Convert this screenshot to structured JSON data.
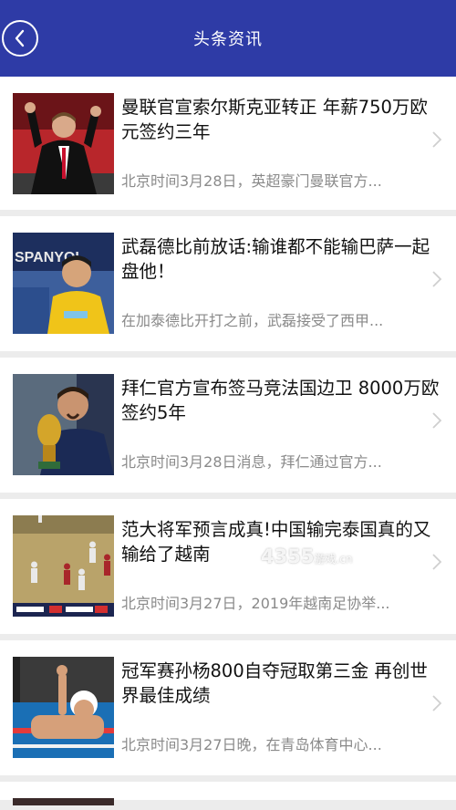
{
  "header": {
    "title": "头条资讯",
    "back_icon": "back-arrow-icon"
  },
  "news": [
    {
      "title": "曼联官宣索尔斯克亚转正 年薪750万欧元签约三年",
      "summary": "北京时间3月28日，英超豪门曼联官方..."
    },
    {
      "title": "武磊德比前放话:输谁都不能输巴萨一起盘他！",
      "summary": "在加泰德比开打之前，武磊接受了西甲..."
    },
    {
      "title": "拜仁官方宣布签马竞法国边卫 8000万欧签约5年",
      "summary": "北京时间3月28日消息，拜仁通过官方..."
    },
    {
      "title": "范大将军预言成真!中国输完泰国真的又输给了越南",
      "summary": "北京时间3月27日，2019年越南足协举..."
    },
    {
      "title": "冠军赛孙杨800自夺冠取第三金 再创世界最佳成绩",
      "summary": "北京时间3月27日晚，在青岛体育中心..."
    }
  ],
  "watermark": {
    "text": "4355",
    "suffix": "游戏",
    "domain": ".cn"
  },
  "colors": {
    "header_bg": "#2e3ba6",
    "page_bg": "#ececec"
  }
}
